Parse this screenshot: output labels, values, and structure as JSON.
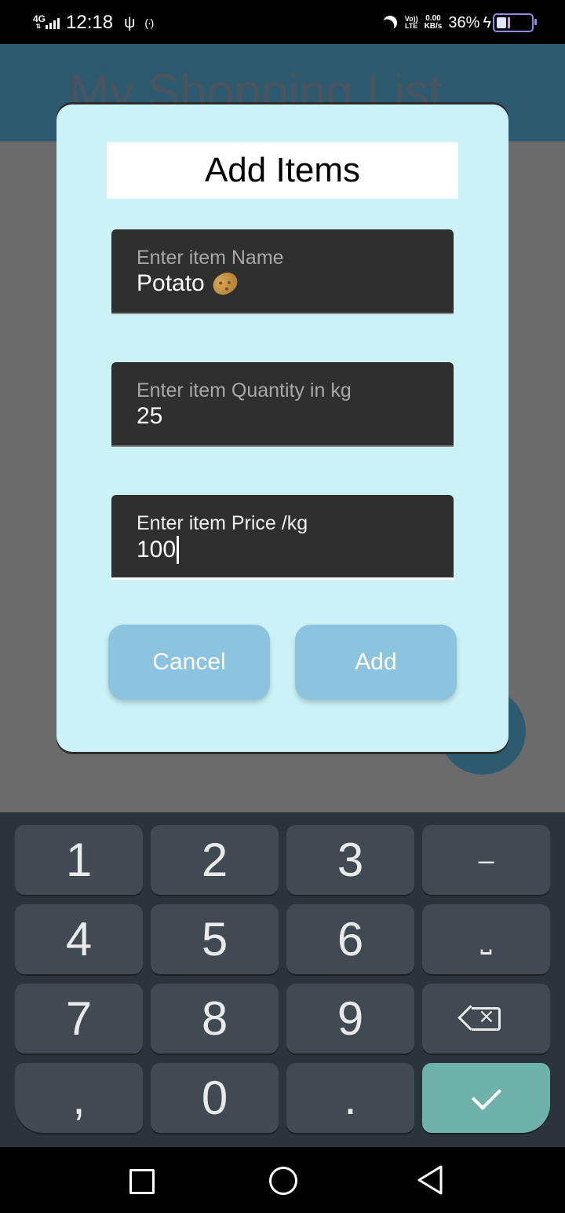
{
  "status_bar": {
    "network": "4G",
    "time": "12:18",
    "volte_line1": "Vo))",
    "volte_line2": "LTE",
    "speed_value": "0.00",
    "speed_unit": "KB/s",
    "battery_percent": "36%"
  },
  "app": {
    "title": "My Shopping List"
  },
  "dialog": {
    "title": "Add Items",
    "fields": [
      {
        "label": "Enter item Name",
        "value": "Potato",
        "emoji_icon": "potato-emoji"
      },
      {
        "label": "Enter item Quantity in kg",
        "value": "25"
      },
      {
        "label": "Enter item Price /kg",
        "value": "100"
      }
    ],
    "cancel_label": "Cancel",
    "add_label": "Add"
  },
  "keyboard": {
    "keys": [
      "1",
      "2",
      "3",
      "–",
      "4",
      "5",
      "6",
      "␣",
      "7",
      "8",
      "9",
      "backspace",
      ",",
      "0",
      ".",
      "enter"
    ],
    "digit_1": "1",
    "digit_2": "2",
    "digit_3": "3",
    "minus": "–",
    "digit_4": "4",
    "digit_5": "5",
    "digit_6": "6",
    "space": "⎵",
    "digit_7": "7",
    "digit_8": "8",
    "digit_9": "9",
    "comma": ",",
    "digit_0": "0",
    "period": "."
  },
  "colors": {
    "dialog_bg": "#cbf2f6",
    "button_bg": "#8cc3de",
    "field_bg": "#2f2f2f",
    "keyboard_bg": "#2c343b",
    "enter_key": "#6fb2ab",
    "app_bar": "#2e5a70"
  }
}
